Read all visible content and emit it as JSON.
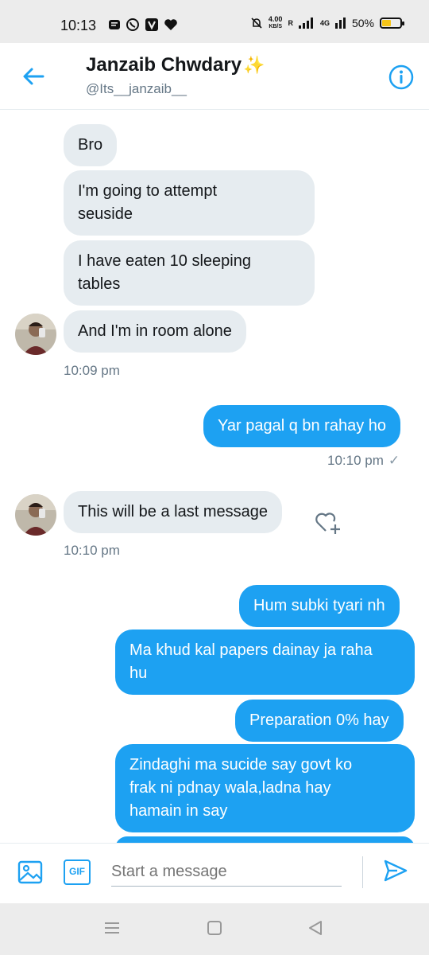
{
  "status_bar": {
    "time": "10:13",
    "net_speed_value": "4.00",
    "net_speed_unit": "KB/S",
    "network_type": "4G",
    "battery_percent": "50%",
    "roaming": "R"
  },
  "header": {
    "name": "Janzaib Chwdary",
    "handle": "@Its__janzaib__",
    "accent_color": "#1da1f2"
  },
  "messages": [
    {
      "dir": "in",
      "text": "Bro"
    },
    {
      "dir": "in",
      "text": "I'm going to attempt\nseuside"
    },
    {
      "dir": "in",
      "text": "I have eaten 10 sleeping\ntables"
    },
    {
      "dir": "in",
      "text": "And I'm in room alone"
    },
    {
      "dir": "out",
      "text": "Yar pagal q bn rahay ho"
    },
    {
      "dir": "in",
      "text": "This will be a last message"
    },
    {
      "dir": "out",
      "text": "Hum subki tyari nh"
    },
    {
      "dir": "out",
      "text": "Ma khud kal papers dainay ja raha\nhu"
    },
    {
      "dir": "out",
      "text": "Preparation 0% hay"
    },
    {
      "dir": "out",
      "text": "Zindaghi ma sucide say govt ko\nfrak ni pdnay wala,ladna hay\nhamain in say"
    }
  ],
  "timestamps": {
    "group1": "10:09 pm",
    "group2": "10:10 pm",
    "group3": "10:10 pm"
  },
  "composer": {
    "placeholder": "Start a message",
    "gif_label": "GIF"
  }
}
